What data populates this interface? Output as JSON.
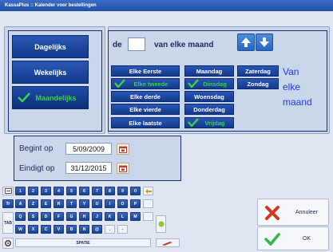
{
  "window": {
    "title": "KassaPlus :: Kalender voor bestellingen"
  },
  "modes": [
    {
      "label": "Dagelijks",
      "selected": false
    },
    {
      "label": "Wekelijks",
      "selected": false
    },
    {
      "label": "Maandelijks",
      "selected": true
    }
  ],
  "monthly": {
    "de_label": "de",
    "day_value": "",
    "suffix_label": "van elke maand",
    "side_text": [
      "Van",
      "elke",
      "maand"
    ]
  },
  "ordinals": [
    {
      "label": "Elke Eerste",
      "selected": false
    },
    {
      "label": "Elke tweede",
      "selected": true
    },
    {
      "label": "Elke derde",
      "selected": false
    },
    {
      "label": "Elke vierde",
      "selected": false
    },
    {
      "label": "Elke laatste",
      "selected": false
    }
  ],
  "weekdays": [
    {
      "label": "Maandag",
      "selected": false
    },
    {
      "label": "Dinsdag",
      "selected": true
    },
    {
      "label": "Woensdag",
      "selected": false
    },
    {
      "label": "Donderdag",
      "selected": false
    },
    {
      "label": "Vrijdag",
      "selected": true
    }
  ],
  "weekend": [
    {
      "label": "Zaterdag",
      "selected": false
    },
    {
      "label": "Zondag",
      "selected": false
    }
  ],
  "dates": {
    "start_label": "Begint op",
    "start_value": "5/09/2009",
    "end_label": "Eindigt op",
    "end_value": "31/12/2015"
  },
  "keyboard": {
    "row1": [
      "1",
      "2",
      "3",
      "4",
      "5",
      "6",
      "7",
      "8",
      "9",
      "0"
    ],
    "row2": [
      "A",
      "Z",
      "E",
      "R",
      "T",
      "Y",
      "U",
      "I",
      "O",
      "P"
    ],
    "row3": [
      "Q",
      "S",
      "D",
      "F",
      "G",
      "H",
      "J",
      "K",
      "L",
      "M"
    ],
    "row4": [
      "W",
      "X",
      "C",
      "V",
      "B",
      "N",
      "@",
      ".",
      "-"
    ],
    "tab_label": "TAB",
    "tr_label": "Tr",
    "space_label": "SPATIE"
  },
  "actions": {
    "cancel_label": "Annuleer",
    "ok_label": "OK"
  },
  "colors": {
    "accent": "#1c4aa0",
    "check": "#38c24a",
    "side_text": "#1f3ad8"
  }
}
